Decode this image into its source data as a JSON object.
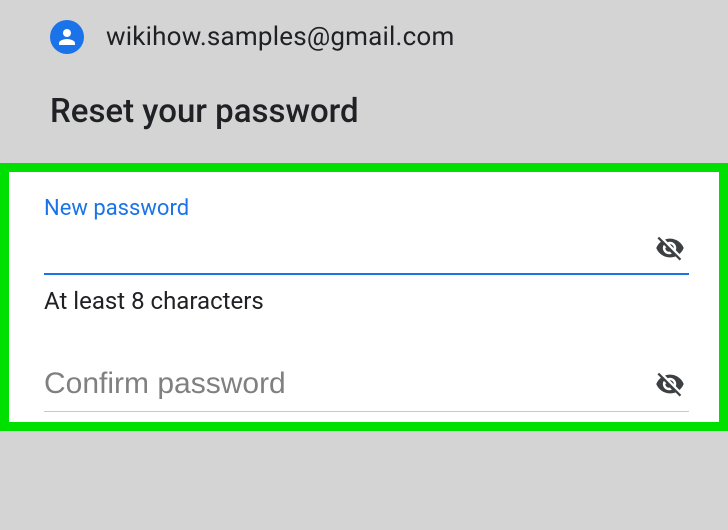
{
  "header": {
    "email": "wikihow.samples@gmail.com"
  },
  "title": "Reset your password",
  "form": {
    "new_password_label": "New password",
    "new_password_value": "",
    "hint": "At least 8 characters",
    "confirm_placeholder": "Confirm password",
    "confirm_value": ""
  }
}
